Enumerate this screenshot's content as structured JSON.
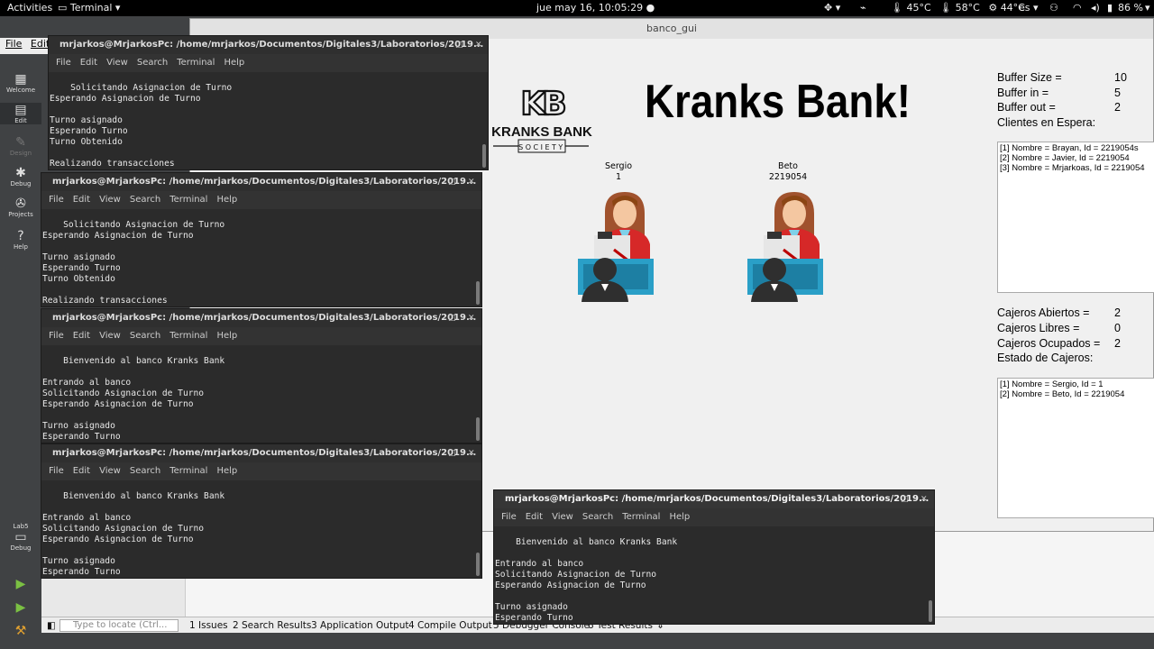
{
  "topbar": {
    "activities": "Activities",
    "app_name": "Terminal",
    "clock": "jue may 16, 10:05:29",
    "temp1": "45°C",
    "temp2": "58°C",
    "temp3": "44°C",
    "lang": "es",
    "battery": "86 %"
  },
  "qtc": {
    "menu_file": "File",
    "menu_edit": "Edit",
    "modes": {
      "welcome": "Welcome",
      "edit": "Edit",
      "design": "Design",
      "debug": "Debug",
      "projects": "Projects",
      "help": "Help",
      "kit": "Lab5",
      "kit_mode": "Debug"
    },
    "locate_placeholder": "Type to locate (Ctrl...",
    "panes": [
      "1  Issues",
      "2  Search Results",
      "3  Application Output",
      "4  Compile Output",
      "5  Debugger Console",
      "8  Test Results"
    ]
  },
  "gui": {
    "window_title": "banco_gui",
    "bank_title": "Kranks Bank!",
    "logo": {
      "monogram": "KB",
      "name": "KRANKS BANK",
      "sub": "SOCIETY"
    },
    "cashiers": [
      {
        "name": "Sergio",
        "id": "1"
      },
      {
        "name": "Beto",
        "id": "2219054"
      }
    ],
    "buffer": {
      "size_label": "Buffer Size =",
      "size_value": "10",
      "in_label": "Buffer in =",
      "in_value": "5",
      "out_label": "Buffer out =",
      "out_value": "2",
      "clients_label": "Clientes en Espera:"
    },
    "clients": [
      "[1] Nombre = Brayan, Id = 2219054s",
      "[2] Nombre = Javier, Id = 2219054",
      "[3] Nombre = Mrjarkoas, Id = 2219054"
    ],
    "cajeros": {
      "abiertos_label": "Cajeros Abiertos =",
      "abiertos_value": "2",
      "libres_label": "Cajeros Libres =",
      "libres_value": "0",
      "ocupados_label": "Cajeros Ocupados =",
      "ocupados_value": "2",
      "estado_label": "Estado de Cajeros:"
    },
    "estado": [
      "[1] Nombre = Sergio, Id = 1",
      "[2] Nombre = Beto, Id = 2219054"
    ]
  },
  "term_menu": [
    "File",
    "Edit",
    "View",
    "Search",
    "Terminal",
    "Help"
  ],
  "terminals": [
    {
      "title": "mrjarkos@MrjarkosPc: /home/mrjarkos/Documentos/Digitales3/Laboratorios/2019...",
      "text": "Solicitando Asignacion de Turno\nEsperando Asignacion de Turno\n\nTurno asignado\nEsperando Turno\nTurno Obtenido\n\nRealizando transacciones"
    },
    {
      "title": "mrjarkos@MrjarkosPc: /home/mrjarkos/Documentos/Digitales3/Laboratorios/2019...",
      "text": "Solicitando Asignacion de Turno\nEsperando Asignacion de Turno\n\nTurno asignado\nEsperando Turno\nTurno Obtenido\n\nRealizando transacciones"
    },
    {
      "title": "mrjarkos@MrjarkosPc: /home/mrjarkos/Documentos/Digitales3/Laboratorios/2019...",
      "text": "Bienvenido al banco Kranks Bank\n\nEntrando al banco\nSolicitando Asignacion de Turno\nEsperando Asignacion de Turno\n\nTurno asignado\nEsperando Turno"
    },
    {
      "title": "mrjarkos@MrjarkosPc: /home/mrjarkos/Documentos/Digitales3/Laboratorios/2019...",
      "text": "Bienvenido al banco Kranks Bank\n\nEntrando al banco\nSolicitando Asignacion de Turno\nEsperando Asignacion de Turno\n\nTurno asignado\nEsperando Turno"
    },
    {
      "title": "mrjarkos@MrjarkosPc: /home/mrjarkos/Documentos/Digitales3/Laboratorios/2019...",
      "text": "Bienvenido al banco Kranks Bank\n\nEntrando al banco\nSolicitando Asignacion de Turno\nEsperando Asignacion de Turno\n\nTurno asignado\nEsperando Turno"
    }
  ]
}
